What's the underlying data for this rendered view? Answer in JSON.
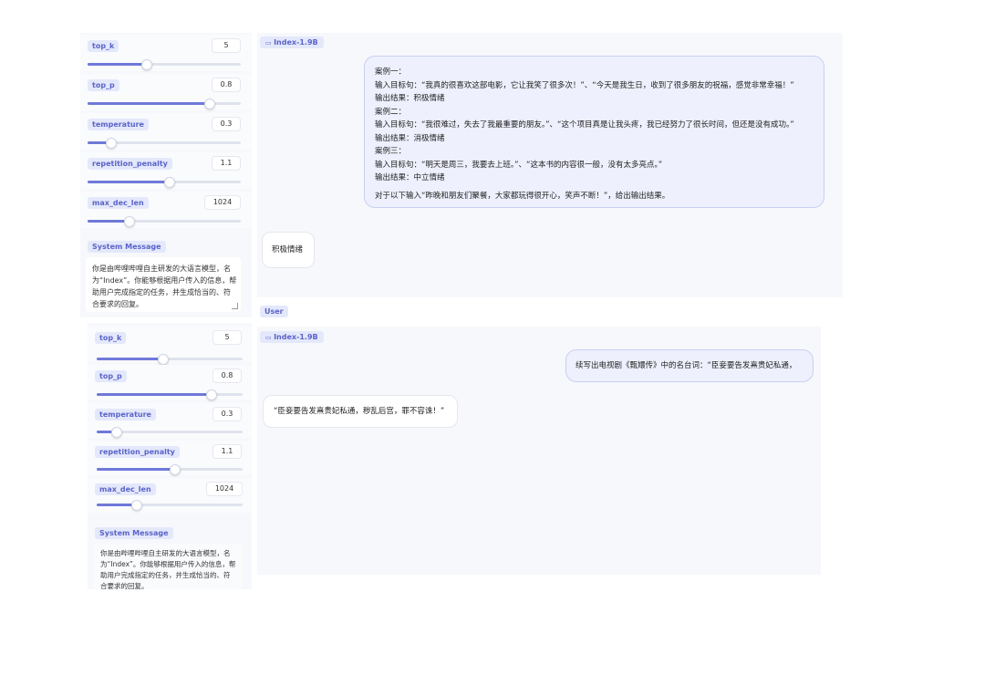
{
  "panel1": {
    "params": [
      {
        "label": "top_k",
        "value": "5",
        "fill": 0.38
      },
      {
        "label": "top_p",
        "value": "0.8",
        "fill": 0.79
      },
      {
        "label": "temperature",
        "value": "0.3",
        "fill": 0.15
      },
      {
        "label": "repetition_penalty",
        "value": "1.1",
        "fill": 0.53
      },
      {
        "label": "max_dec_len",
        "value": "1024",
        "fill": 0.27
      }
    ],
    "system_label": "System Message",
    "system_text": [
      "你是由哔哩哔哩自主研发的大语言模型，名",
      "为“Index”。你能够根据用户传入的信息，帮",
      "助用户完成指定的任务，并生成恰当的、符",
      "合要求的回复。"
    ],
    "model_label": "Index-1.9B",
    "user_lines": [
      "案例一：",
      "输入目标句：“我真的很喜欢这部电影，它让我笑了很多次！”、“今天是我生日，收到了很多朋友的祝福，感觉非常幸福！”",
      "输出结果：积极情绪",
      "案例二：",
      "输入目标句：“我很难过，失去了我最重要的朋友。”、“这个项目真是让我头疼，我已经努力了很长时间，但还是没有成功。”",
      "输出结果：消极情绪",
      "案例三：",
      "输入目标句：“明天是周三，我要去上班。”、“这本书的内容很一般，没有太多亮点。”",
      "输出结果：中立情绪"
    ],
    "user_final": "对于以下输入“昨晚和朋友们聚餐，大家都玩得很开心，笑声不断！”，给出输出结果。",
    "bot_reply": "积极情绪",
    "bottom_label": "User"
  },
  "panel2": {
    "params": [
      {
        "label": "top_k",
        "value": "5",
        "fill": 0.45
      },
      {
        "label": "top_p",
        "value": "0.8",
        "fill": 0.78
      },
      {
        "label": "temperature",
        "value": "0.3",
        "fill": 0.13
      },
      {
        "label": "repetition_penalty",
        "value": "1.1",
        "fill": 0.53
      },
      {
        "label": "max_dec_len",
        "value": "1024",
        "fill": 0.27
      }
    ],
    "system_label": "System Message",
    "system_text": [
      "你是由哔哩哔哩自主研发的大语言模型，名",
      "为“Index”。你能够根据用户传入的信息，帮",
      "助用户完成指定的任务，并生成恰当的、符",
      "合要求的回复。"
    ],
    "model_label": "Index-1.9B",
    "user_text": "续写出电视剧《甄嬛传》中的名台词：“臣妾要告发熹贵妃私通，",
    "bot_reply": "“臣妾要告发熹贵妃私通，秽乱后宫，罪不容诛！”"
  }
}
